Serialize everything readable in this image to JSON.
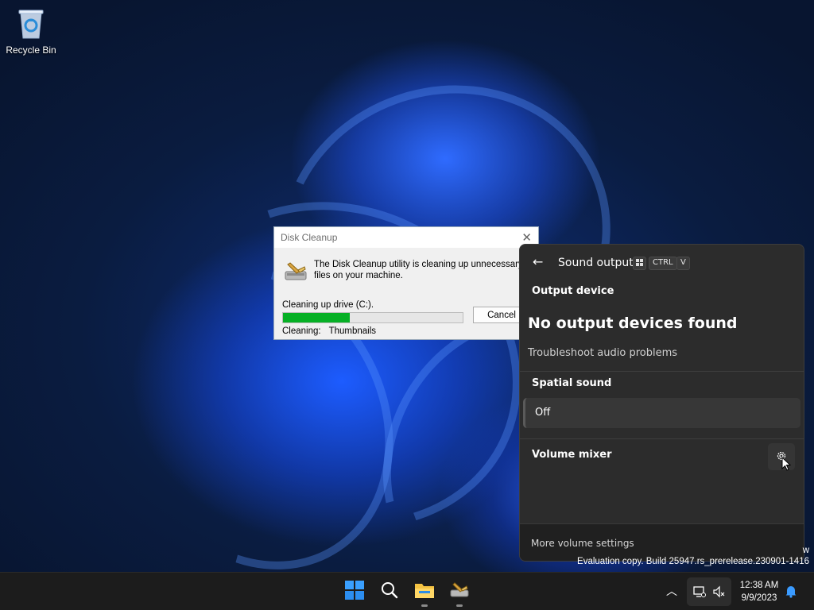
{
  "desktop": {
    "recycle_bin_label": "Recycle Bin"
  },
  "disk_cleanup": {
    "title": "Disk Cleanup",
    "message": "The Disk Cleanup utility is cleaning up unnecessary files on your machine.",
    "status": "Cleaning up drive  (C:).",
    "progress": 0.37,
    "cleaning_label": "Cleaning:",
    "cleaning_item": "Thumbnails",
    "cancel_label": "Cancel"
  },
  "sound_flyout": {
    "title": "Sound output",
    "shortcut": [
      "CTRL",
      "V"
    ],
    "output_device_label": "Output device",
    "no_devices_message": "No output devices found",
    "troubleshoot_link": "Troubleshoot audio problems",
    "spatial_sound_label": "Spatial sound",
    "spatial_sound_value": "Off",
    "volume_mixer_label": "Volume mixer",
    "more_settings_link": "More volume settings"
  },
  "watermark": {
    "line1": "w",
    "line2": "Evaluation copy. Build 25947.rs_prerelease.230901-1416"
  },
  "taskbar": {
    "clock_time": "12:38 AM",
    "clock_date": "9/9/2023",
    "icons": [
      "start-icon",
      "search-icon",
      "file-explorer-icon",
      "disk-cleanup-icon"
    ]
  },
  "colors": {
    "progress_fill": "#06b025",
    "flyout_bg": "#2c2c2c",
    "accent": "#0078d4"
  }
}
